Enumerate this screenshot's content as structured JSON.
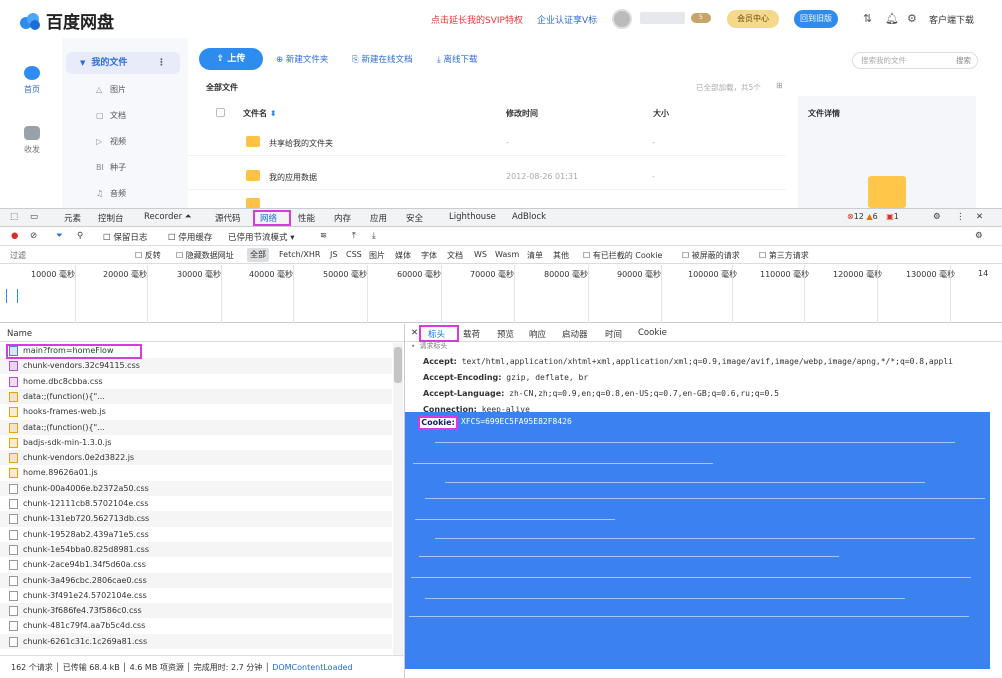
{
  "app": {
    "name": "百度网盘",
    "promo": "点击延长我的SVIP特权",
    "enterprise": "企业认证享V标",
    "username_masked": "",
    "level": "5",
    "vip_center": "会员中心",
    "back_to_old": "回到旧版",
    "client_download": "客户端下载"
  },
  "rail": {
    "home": "首页",
    "favorites": "收发"
  },
  "tree": {
    "my_files": "我的文件",
    "items": [
      {
        "icon": "image-icon",
        "label": "图片"
      },
      {
        "icon": "doc-icon",
        "label": "文档"
      },
      {
        "icon": "video-icon",
        "label": "视频"
      },
      {
        "icon": "torrent-icon",
        "label": "种子"
      },
      {
        "icon": "audio-icon",
        "label": "音频"
      }
    ]
  },
  "toolbar": {
    "upload": "上传",
    "new_folder": "新建文件夹",
    "new_online": "新建在线文档",
    "offline": "离线下载",
    "search_placeholder": "搜索我的文件",
    "search": "搜索"
  },
  "files": {
    "breadcrumb": "全部文件",
    "loaded": "已全部加载，共5个",
    "columns": {
      "name": "文件名",
      "modified": "修改时间",
      "size": "大小"
    },
    "detail_title": "文件详情",
    "rows": [
      {
        "name": "共享给我的文件夹",
        "date": "-",
        "size": "-"
      },
      {
        "name": "我的应用数据",
        "date": "2012-08-26 01:31",
        "size": "-"
      }
    ]
  },
  "devtools": {
    "tabs": [
      "元素",
      "控制台",
      "Recorder ⏶",
      "源代码",
      "网络",
      "性能",
      "内存",
      "应用",
      "安全",
      "Lighthouse",
      "AdBlock"
    ],
    "errors": "12",
    "warnings": "6",
    "issues": "1",
    "netbar": {
      "preserve_log": "保留日志",
      "disable_cache": "停用缓存",
      "throttle": "已停用节流模式"
    },
    "filter": {
      "placeholder": "过滤",
      "invert": "反转",
      "hide_data": "隐藏数据网址",
      "all": "全部",
      "types": [
        "Fetch/XHR",
        "JS",
        "CSS",
        "图片",
        "媒体",
        "字体",
        "文档",
        "WS",
        "Wasm",
        "清单",
        "其他"
      ],
      "blocked_cookies": "有已拦截的 Cookie",
      "blocked_requests": "被屏蔽的请求",
      "third_party": "第三方请求"
    },
    "timeline_ticks": [
      "10000 毫秒",
      "20000 毫秒",
      "30000 毫秒",
      "40000 毫秒",
      "50000 毫秒",
      "60000 毫秒",
      "70000 毫秒",
      "80000 毫秒",
      "90000 毫秒",
      "100000 毫秒",
      "110000 毫秒",
      "120000 毫秒",
      "130000 毫秒",
      "14"
    ],
    "name_header": "Name",
    "requests": [
      "main?from=homeFlow",
      "chunk-vendors.32c94115.css",
      "home.dbc8cbba.css",
      "data:;(function(){\"...",
      "hooks-frames-web.js",
      "data:;(function(){\"...",
      "badjs-sdk-min-1.3.0.js",
      "chunk-vendors.0e2d3822.js",
      "home.89626a01.js",
      "chunk-00a4006e.b2372a50.css",
      "chunk-12111cb8.5702104e.css",
      "chunk-131eb720.562713db.css",
      "chunk-19528ab2.439a71e5.css",
      "chunk-1e54bba0.825d8981.css",
      "chunk-2ace94b1.34f5d60a.css",
      "chunk-3a496cbc.2806cae0.css",
      "chunk-3f491e24.5702104e.css",
      "chunk-3f686fe4.73f586c0.css",
      "chunk-481c79f4.aa7b5c4d.css",
      "chunk-6261c31c.1c269a81.css"
    ],
    "status": {
      "requests": "162 个请求",
      "transferred": "已传输 68.4 kB",
      "resources": "4.6 MB 项资源",
      "finish": "完成用时: 2.7 分钟",
      "dcl": "DOMContentLoaded"
    },
    "detail_tabs": [
      "标头",
      "载荷",
      "预览",
      "响应",
      "启动器",
      "时间",
      "Cookie"
    ],
    "request_headers_title": "请求标头",
    "headers": [
      {
        "k": "Accept:",
        "v": "text/html,application/xhtml+xml,application/xml;q=0.9,image/avif,image/webp,image/apng,*/*;q=0.8,appli"
      },
      {
        "k": "Accept-Encoding:",
        "v": "gzip, deflate, br"
      },
      {
        "k": "Accept-Language:",
        "v": "zh-CN,zh;q=0.9,en;q=0.8,en-US;q=0.7,en-GB;q=0.6,ru;q=0.5"
      },
      {
        "k": "Connection:",
        "v": "keep-alive"
      }
    ],
    "cookie_key": "Cookie:",
    "cookie_value": "XFCS=699EC5FA95E82F8426"
  },
  "colors": {
    "accent": "#2e8cf0",
    "highlight": "#d63be0",
    "redact": "#3b82f0"
  }
}
